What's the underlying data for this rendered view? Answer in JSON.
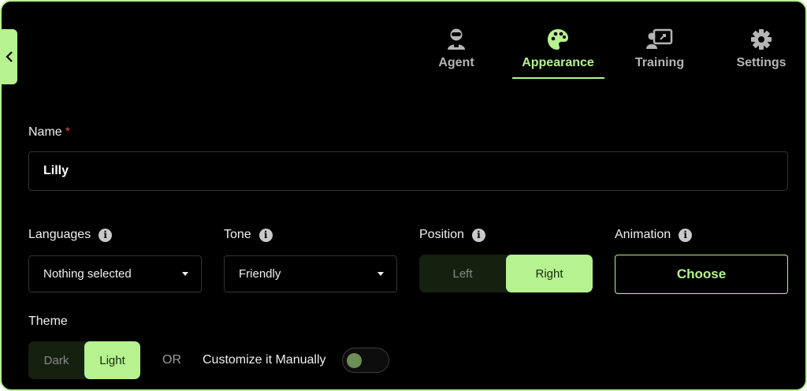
{
  "tabs": [
    {
      "label": "Agent",
      "icon": "agent-icon",
      "active": false
    },
    {
      "label": "Appearance",
      "icon": "palette-icon",
      "active": true
    },
    {
      "label": "Training",
      "icon": "training-icon",
      "active": false
    },
    {
      "label": "Settings",
      "icon": "gear-icon",
      "active": false
    }
  ],
  "form": {
    "name_label": "Name",
    "name_required": "*",
    "name_value": "Lilly",
    "languages_label": "Languages",
    "languages_value": "Nothing selected",
    "tone_label": "Tone",
    "tone_value": "Friendly",
    "position_label": "Position",
    "position_options": [
      "Left",
      "Right"
    ],
    "position_selected": "Right",
    "animation_label": "Animation",
    "animation_button": "Choose",
    "theme_label": "Theme",
    "theme_options": [
      "Dark",
      "Light"
    ],
    "theme_selected": "Light",
    "or_text": "OR",
    "customize_label": "Customize it Manually",
    "customize_enabled": false,
    "info_glyph": "i"
  },
  "colors": {
    "accent": "#b6f290",
    "background": "#000000",
    "required": "#e5484d"
  }
}
